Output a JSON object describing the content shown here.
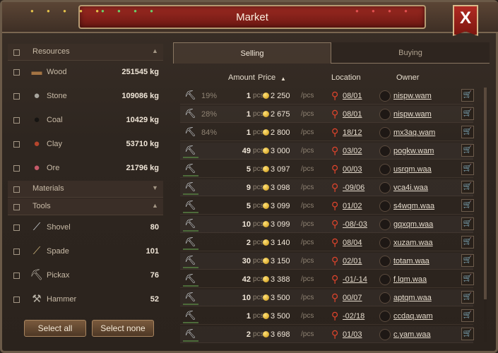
{
  "header": {
    "title": "Market",
    "close_glyph": "X"
  },
  "left": {
    "groups": [
      {
        "label": "Resources",
        "arrow": "▲"
      },
      {
        "label": "Materials",
        "arrow": "▼"
      },
      {
        "label": "Tools",
        "arrow": "▲"
      }
    ],
    "resources": [
      {
        "name": "Wood",
        "qty": "251545 kg",
        "icon": "wood-icon"
      },
      {
        "name": "Stone",
        "qty": "109086 kg",
        "icon": "stone-icon"
      },
      {
        "name": "Coal",
        "qty": "10429 kg",
        "icon": "coal-icon"
      },
      {
        "name": "Clay",
        "qty": "53710 kg",
        "icon": "clay-icon"
      },
      {
        "name": "Ore",
        "qty": "21796 kg",
        "icon": "ore-icon"
      }
    ],
    "tools": [
      {
        "name": "Shovel",
        "qty": "80",
        "icon": "shovel-icon"
      },
      {
        "name": "Spade",
        "qty": "101",
        "icon": "spade-icon"
      },
      {
        "name": "Pickax",
        "qty": "76",
        "icon": "pickax-icon"
      },
      {
        "name": "Hammer",
        "qty": "52",
        "icon": "hammer-icon"
      }
    ],
    "select_all": "Select all",
    "select_none": "Select none"
  },
  "tabs": {
    "selling": "Selling",
    "buying": "Buying"
  },
  "columns": {
    "amount": "Amount",
    "price": "Price",
    "sort_arrow": "▲",
    "location": "Location",
    "owner": "Owner"
  },
  "units": {
    "pcs": "pcs",
    "per_pcs": "/pcs"
  },
  "rows": [
    {
      "pct": "19%",
      "amount": "1",
      "price": "2 250",
      "location": "08/01",
      "owner": "nispw.wam"
    },
    {
      "pct": "28%",
      "amount": "1",
      "price": "2 675",
      "location": "08/01",
      "owner": "nispw.wam"
    },
    {
      "pct": "84%",
      "amount": "1",
      "price": "2 800",
      "location": "18/12",
      "owner": "mx3aq.wam"
    },
    {
      "pct": "",
      "amount": "49",
      "price": "3 000",
      "location": "03/02",
      "owner": "pogkw.wam"
    },
    {
      "pct": "",
      "amount": "5",
      "price": "3 097",
      "location": "00/03",
      "owner": "usrqm.waa"
    },
    {
      "pct": "",
      "amount": "9",
      "price": "3 098",
      "location": "-09/06",
      "owner": "vca4i.waa"
    },
    {
      "pct": "",
      "amount": "5",
      "price": "3 099",
      "location": "01/02",
      "owner": "s4wqm.waa"
    },
    {
      "pct": "",
      "amount": "10",
      "price": "3 099",
      "location": "-08/-03",
      "owner": "gqxqm.waa"
    },
    {
      "pct": "",
      "amount": "2",
      "price": "3 140",
      "location": "08/04",
      "owner": "xuzam.waa"
    },
    {
      "pct": "",
      "amount": "30",
      "price": "3 150",
      "location": "02/01",
      "owner": "totam.waa"
    },
    {
      "pct": "",
      "amount": "42",
      "price": "3 388",
      "location": "-01/-14",
      "owner": "f.lqm.waa"
    },
    {
      "pct": "",
      "amount": "10",
      "price": "3 500",
      "location": "00/07",
      "owner": "aptqm.waa"
    },
    {
      "pct": "",
      "amount": "1",
      "price": "3 500",
      "location": "-02/18",
      "owner": "ccdaq.wam"
    },
    {
      "pct": "",
      "amount": "2",
      "price": "3 698",
      "location": "01/03",
      "owner": "c.yam.waa"
    }
  ]
}
